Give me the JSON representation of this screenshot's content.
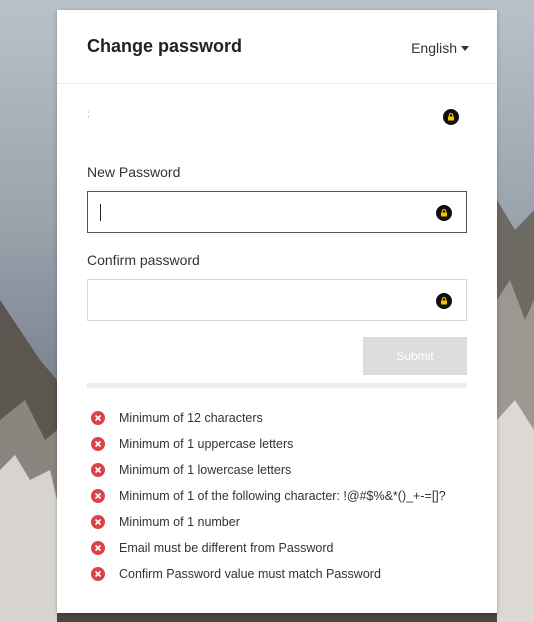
{
  "header": {
    "title": "Change password",
    "language": "English"
  },
  "current": {
    "label": ":"
  },
  "new_password": {
    "label": "New Password",
    "value": ""
  },
  "confirm_password": {
    "label": "Confirm password",
    "value": ""
  },
  "submit_label": "Submit",
  "requirements": [
    {
      "text": "Minimum of 12 characters",
      "status": "fail"
    },
    {
      "text": "Minimum of 1 uppercase letters",
      "status": "fail"
    },
    {
      "text": "Minimum of 1 lowercase letters",
      "status": "fail"
    },
    {
      "text": "Minimum of 1 of the following character: !@#$%&*()_+-=[]?",
      "status": "fail"
    },
    {
      "text": "Minimum of 1 number",
      "status": "fail"
    },
    {
      "text": "Email must be different from Password",
      "status": "fail"
    },
    {
      "text": "Confirm Password value must match Password",
      "status": "fail"
    }
  ],
  "icons": {
    "password_toggle": "lock-icon",
    "requirement_fail": "x-circle-icon",
    "language_dropdown": "caret-down-icon"
  },
  "colors": {
    "fail": "#d9444a",
    "submit_disabled": "#dcdcdc"
  }
}
